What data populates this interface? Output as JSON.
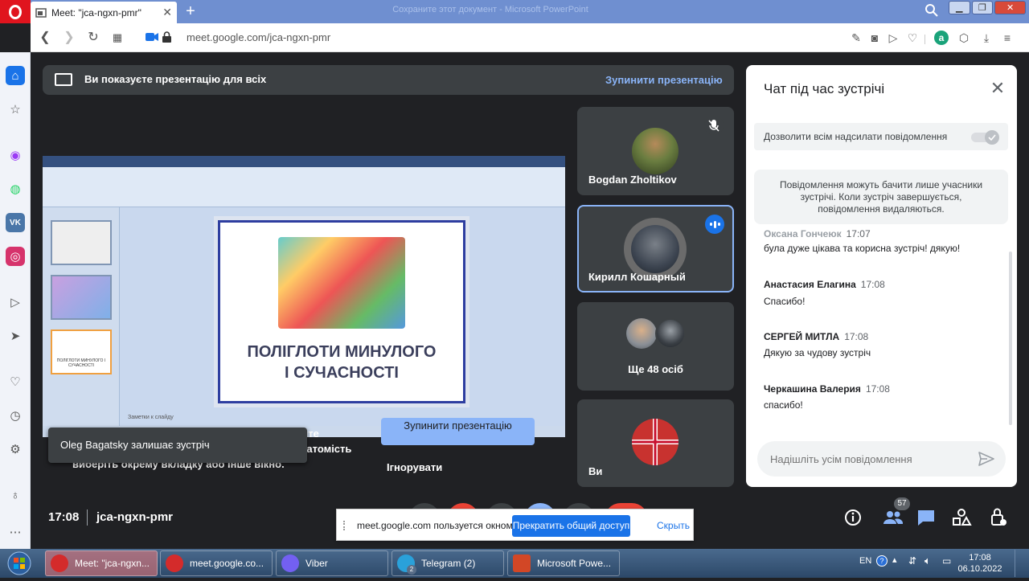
{
  "browser": {
    "tab_title": "Meet: \"jca-ngxn-pmr\"",
    "window_title": "Сохраните этот документ - Microsoft PowerPoint",
    "url": "meet.google.com/jca-ngxn-pmr",
    "new_tab": "+"
  },
  "banner": {
    "text": "Ви показуєте презентацію для всіх",
    "stop_link": "Зупинити презентацію"
  },
  "presentation": {
    "slide_title_line1": "ПОЛІГЛОТИ МИНУЛОГО",
    "slide_title_line2": "І СУЧАСНОСТІ",
    "notes_placeholder": "Заметки к слайду",
    "thumb3_text": "ПОЛІГЛОТИ МИНУЛОГО І СУЧАСНОСТІ"
  },
  "overlay": {
    "text1": "уйте",
    "text2": "Натомість",
    "text3": "виберіть окрему вкладку або інше вікно.",
    "stop_button": "Зупинити презентацію",
    "ignore": "Ігнорувати"
  },
  "toast": {
    "text": "Oleg Bagatsky залишає зустріч"
  },
  "tiles": [
    {
      "name": "Bogdan Zholtikov"
    },
    {
      "name": "Кирилл Кошарный"
    },
    {
      "name": "Ще 48 осіб"
    },
    {
      "name": "Ви"
    }
  ],
  "chat": {
    "title": "Чат під час зустрічі",
    "allow_label": "Дозволити всім надсилати повідомлення",
    "notice": "Повідомлення можуть бачити лише учасники зустрічі. Коли зустріч завершується, повідомлення видаляються.",
    "partial_sender": "Оксана Гончеюк",
    "partial_time": "17:07",
    "partial_text": "була дуже цікава та корисна зустріч! дякую!",
    "messages": [
      {
        "sender": "Анастасия Елагина",
        "time": "17:08",
        "text": "Спасибо!"
      },
      {
        "sender": "СЕРГЕЙ МИТЛА",
        "time": "17:08",
        "text": "Дякую за чудову зустріч"
      },
      {
        "sender": "Черкашина Валерия",
        "time": "17:08",
        "text": "спасибо!"
      }
    ],
    "input_placeholder": "Надішліть усім повідомлення"
  },
  "bottom": {
    "time": "17:08",
    "code": "jca-ngxn-pmr",
    "people_count": "57"
  },
  "sharebar": {
    "text": "meet.google.com пользуется окном.",
    "stop": "Прекратить общий доступ",
    "hide": "Скрыть"
  },
  "taskbar": {
    "items": [
      {
        "label": "Meet: \"jca-ngxn...",
        "color": "#d42b2b"
      },
      {
        "label": "meet.google.co...",
        "color": "#d42b2b"
      },
      {
        "label": "Viber",
        "color": "#7360f2"
      },
      {
        "label": "Telegram (2)",
        "color": "#2aa1da"
      },
      {
        "label": "Microsoft Powe...",
        "color": "#d24726"
      }
    ],
    "telegram_badge": "2",
    "lang": "EN",
    "time": "17:08",
    "date": "06.10.2022"
  }
}
